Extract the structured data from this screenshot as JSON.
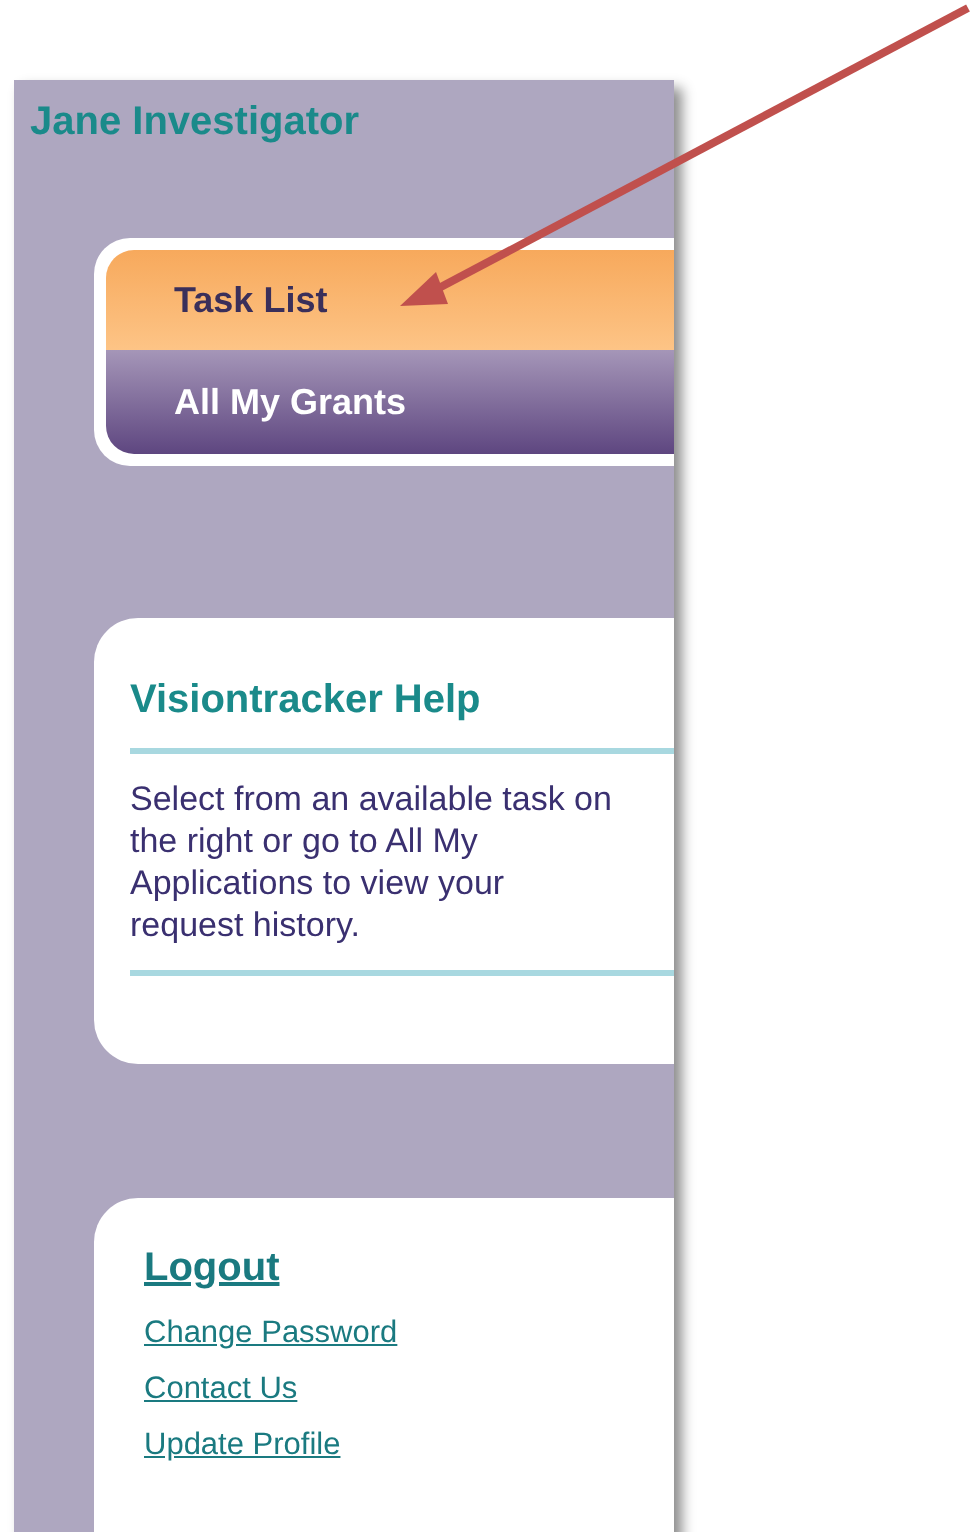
{
  "user": {
    "name": "Jane Investigator"
  },
  "nav": [
    {
      "label": "Task List",
      "selected": true
    },
    {
      "label": "All My Grants",
      "selected": false
    }
  ],
  "help": {
    "title": "Visiontracker Help",
    "text": "Select from an available task on the right or go to All My Applications to view your request history."
  },
  "account_links": [
    {
      "label": "Logout",
      "kind": "primary"
    },
    {
      "label": "Change Password",
      "kind": "secondary"
    },
    {
      "label": "Contact Us",
      "kind": "secondary"
    },
    {
      "label": "Update Profile",
      "kind": "secondary"
    }
  ],
  "annotation": {
    "kind": "arrow"
  }
}
